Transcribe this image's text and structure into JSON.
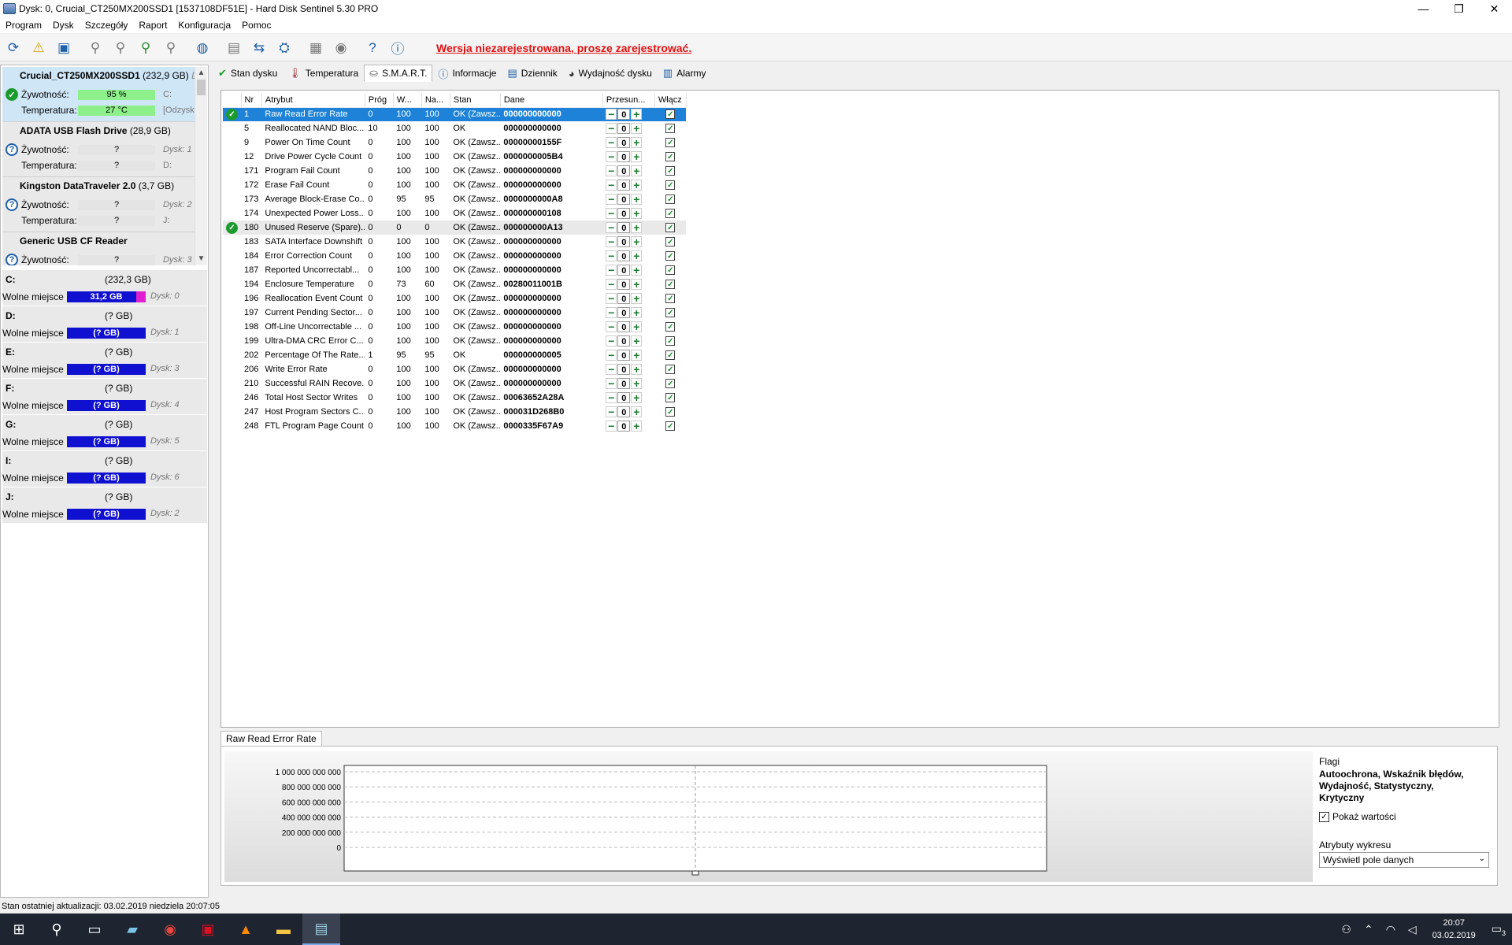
{
  "window": {
    "title": "Dysk: 0, Crucial_CT250MX200SSD1 [1537108DF51E]  -  Hard Disk Sentinel 5.30 PRO",
    "controls": [
      "—",
      "❐",
      "✕"
    ]
  },
  "menu": [
    "Program",
    "Dysk",
    "Szczegóły",
    "Raport",
    "Konfiguracja",
    "Pomoc"
  ],
  "toolbar": {
    "unregistered_text": "Wersja niezarejestrowana, proszę zarejestrować."
  },
  "disks": [
    {
      "name": "Crucial_CT250MX200SSD1",
      "size": "(232,9 GB)",
      "size_extra": "Dy",
      "health_label": "Żywotność:",
      "health": "95 %",
      "health_fraction": 0.95,
      "temp_label": "Temperatura:",
      "temp": "27 °C",
      "health_extra": "C:",
      "temp_extra": "[Odzysk",
      "status": "ok"
    },
    {
      "name": "ADATA   USB Flash Drive",
      "size": "(28,9 GB)",
      "size_extra": "",
      "health_label": "Żywotność:",
      "health": "?",
      "temp_label": "Temperatura:",
      "temp": "?",
      "health_extra": "Dysk: 1",
      "temp_extra": "D:",
      "status": "unknown"
    },
    {
      "name": "Kingston DataTraveler 2.0",
      "size": "(3,7 GB)",
      "size_extra": "",
      "health_label": "Żywotność:",
      "health": "?",
      "temp_label": "Temperatura:",
      "temp": "?",
      "health_extra": "Dysk: 2",
      "temp_extra": "J:",
      "status": "unknown"
    },
    {
      "name": "Generic USB  CF Reader",
      "size": "",
      "size_extra": "",
      "health_label": "Żywotność:",
      "health": "?",
      "temp_label": "",
      "temp": "",
      "health_extra": "Dysk: 3",
      "temp_extra": "",
      "status": "unknown"
    }
  ],
  "volumes": [
    {
      "letter": "C:",
      "size": "(232,3 GB)",
      "free_label": "Wolne miejsce",
      "free": "31,2 GB",
      "disk": "Dysk: 0"
    },
    {
      "letter": "D:",
      "size": "(? GB)",
      "free_label": "Wolne miejsce",
      "free": "(? GB)",
      "disk": "Dysk: 1"
    },
    {
      "letter": "E:",
      "size": "(? GB)",
      "free_label": "Wolne miejsce",
      "free": "(? GB)",
      "disk": "Dysk: 3"
    },
    {
      "letter": "F:",
      "size": "(? GB)",
      "free_label": "Wolne miejsce",
      "free": "(? GB)",
      "disk": "Dysk: 4"
    },
    {
      "letter": "G:",
      "size": "(? GB)",
      "free_label": "Wolne miejsce",
      "free": "(? GB)",
      "disk": "Dysk: 5"
    },
    {
      "letter": "I:",
      "size": "(? GB)",
      "free_label": "Wolne miejsce",
      "free": "(? GB)",
      "disk": "Dysk: 6"
    },
    {
      "letter": "J:",
      "size": "(? GB)",
      "free_label": "Wolne miejsce",
      "free": "(? GB)",
      "disk": "Dysk: 2"
    }
  ],
  "tabs": [
    {
      "label": "Stan dysku",
      "icon": "check-icon"
    },
    {
      "label": "Temperatura",
      "icon": "thermometer-icon"
    },
    {
      "label": "S.M.A.R.T.",
      "icon": "disk-icon",
      "active": true
    },
    {
      "label": "Informacje",
      "icon": "info-icon"
    },
    {
      "label": "Dziennik",
      "icon": "log-icon"
    },
    {
      "label": "Wydajność dysku",
      "icon": "gauge-icon"
    },
    {
      "label": "Alarmy",
      "icon": "alarm-icon"
    }
  ],
  "smart": {
    "headers": {
      "nr": "Nr",
      "attr": "Atrybut",
      "threshold": "Próg",
      "value": "W...",
      "worst": "Na...",
      "state": "Stan",
      "data": "Dane",
      "shift": "Przesun...",
      "enable": "Włącz"
    },
    "rows": [
      {
        "nr": "1",
        "attr": "Raw Read Error Rate",
        "thr": "0",
        "val": "100",
        "worst": "100",
        "state": "OK (Zawsz...",
        "data": "000000000000",
        "shift": "0",
        "icon": true,
        "selected": true
      },
      {
        "nr": "5",
        "attr": "Reallocated NAND Bloc...",
        "thr": "10",
        "val": "100",
        "worst": "100",
        "state": "OK",
        "data": "000000000000",
        "shift": "0"
      },
      {
        "nr": "9",
        "attr": "Power On Time Count",
        "thr": "0",
        "val": "100",
        "worst": "100",
        "state": "OK (Zawsz...",
        "data": "00000000155F",
        "shift": "0"
      },
      {
        "nr": "12",
        "attr": "Drive Power Cycle Count",
        "thr": "0",
        "val": "100",
        "worst": "100",
        "state": "OK (Zawsz...",
        "data": "0000000005B4",
        "shift": "0"
      },
      {
        "nr": "171",
        "attr": "Program Fail Count",
        "thr": "0",
        "val": "100",
        "worst": "100",
        "state": "OK (Zawsz...",
        "data": "000000000000",
        "shift": "0"
      },
      {
        "nr": "172",
        "attr": "Erase Fail Count",
        "thr": "0",
        "val": "100",
        "worst": "100",
        "state": "OK (Zawsz...",
        "data": "000000000000",
        "shift": "0"
      },
      {
        "nr": "173",
        "attr": "Average Block-Erase Co...",
        "thr": "0",
        "val": "95",
        "worst": "95",
        "state": "OK (Zawsz...",
        "data": "0000000000A8",
        "shift": "0"
      },
      {
        "nr": "174",
        "attr": "Unexpected Power Loss...",
        "thr": "0",
        "val": "100",
        "worst": "100",
        "state": "OK (Zawsz...",
        "data": "000000000108",
        "shift": "0"
      },
      {
        "nr": "180",
        "attr": "Unused Reserve (Spare)...",
        "thr": "0",
        "val": "0",
        "worst": "0",
        "state": "OK (Zawsz...",
        "data": "000000000A13",
        "shift": "0",
        "icon": true,
        "highlight": true
      },
      {
        "nr": "183",
        "attr": "SATA Interface Downshift",
        "thr": "0",
        "val": "100",
        "worst": "100",
        "state": "OK (Zawsz...",
        "data": "000000000000",
        "shift": "0"
      },
      {
        "nr": "184",
        "attr": "Error Correction Count",
        "thr": "0",
        "val": "100",
        "worst": "100",
        "state": "OK (Zawsz...",
        "data": "000000000000",
        "shift": "0"
      },
      {
        "nr": "187",
        "attr": "Reported Uncorrectabl...",
        "thr": "0",
        "val": "100",
        "worst": "100",
        "state": "OK (Zawsz...",
        "data": "000000000000",
        "shift": "0"
      },
      {
        "nr": "194",
        "attr": "Enclosure Temperature",
        "thr": "0",
        "val": "73",
        "worst": "60",
        "state": "OK (Zawsz...",
        "data": "00280011001B",
        "shift": "0"
      },
      {
        "nr": "196",
        "attr": "Reallocation Event Count",
        "thr": "0",
        "val": "100",
        "worst": "100",
        "state": "OK (Zawsz...",
        "data": "000000000000",
        "shift": "0"
      },
      {
        "nr": "197",
        "attr": "Current Pending Sector...",
        "thr": "0",
        "val": "100",
        "worst": "100",
        "state": "OK (Zawsz...",
        "data": "000000000000",
        "shift": "0"
      },
      {
        "nr": "198",
        "attr": "Off-Line Uncorrectable ...",
        "thr": "0",
        "val": "100",
        "worst": "100",
        "state": "OK (Zawsz...",
        "data": "000000000000",
        "shift": "0"
      },
      {
        "nr": "199",
        "attr": "Ultra-DMA CRC Error C...",
        "thr": "0",
        "val": "100",
        "worst": "100",
        "state": "OK (Zawsz...",
        "data": "000000000000",
        "shift": "0"
      },
      {
        "nr": "202",
        "attr": "Percentage Of The Rate...",
        "thr": "1",
        "val": "95",
        "worst": "95",
        "state": "OK",
        "data": "000000000005",
        "shift": "0"
      },
      {
        "nr": "206",
        "attr": "Write Error Rate",
        "thr": "0",
        "val": "100",
        "worst": "100",
        "state": "OK (Zawsz...",
        "data": "000000000000",
        "shift": "0"
      },
      {
        "nr": "210",
        "attr": "Successful RAIN Recove...",
        "thr": "0",
        "val": "100",
        "worst": "100",
        "state": "OK (Zawsz...",
        "data": "000000000000",
        "shift": "0"
      },
      {
        "nr": "246",
        "attr": "Total Host Sector Writes",
        "thr": "0",
        "val": "100",
        "worst": "100",
        "state": "OK (Zawsz...",
        "data": "00063652A28A",
        "shift": "0"
      },
      {
        "nr": "247",
        "attr": "Host Program Sectors C...",
        "thr": "0",
        "val": "100",
        "worst": "100",
        "state": "OK (Zawsz...",
        "data": "000031D268B0",
        "shift": "0"
      },
      {
        "nr": "248",
        "attr": "FTL Program Page Count",
        "thr": "0",
        "val": "100",
        "worst": "100",
        "state": "OK (Zawsz...",
        "data": "0000335F67A9",
        "shift": "0"
      }
    ]
  },
  "graph": {
    "tab_label": "Raw Read Error Rate",
    "y_ticks": [
      "1 000 000 000 000",
      "800 000 000 000",
      "600 000 000 000",
      "400 000 000 000",
      "200 000 000 000",
      "0"
    ],
    "flags_title": "Flagi",
    "flags_value": "Autoochrona, Wskaźnik błędów, Wydajność, Statystyczny, Krytyczny",
    "show_values_label": "Pokaż wartości",
    "show_values_checked": true,
    "graph_attr_label": "Atrybuty wykresu",
    "graph_attr_value": "Wyświetl pole danych"
  },
  "statusbar": "Stan ostatniej aktualizacji: 03.02.2019 niedziela 20:07:05",
  "taskbar": {
    "time": "20:07",
    "date": "03.02.2019",
    "notification_count": "3"
  }
}
